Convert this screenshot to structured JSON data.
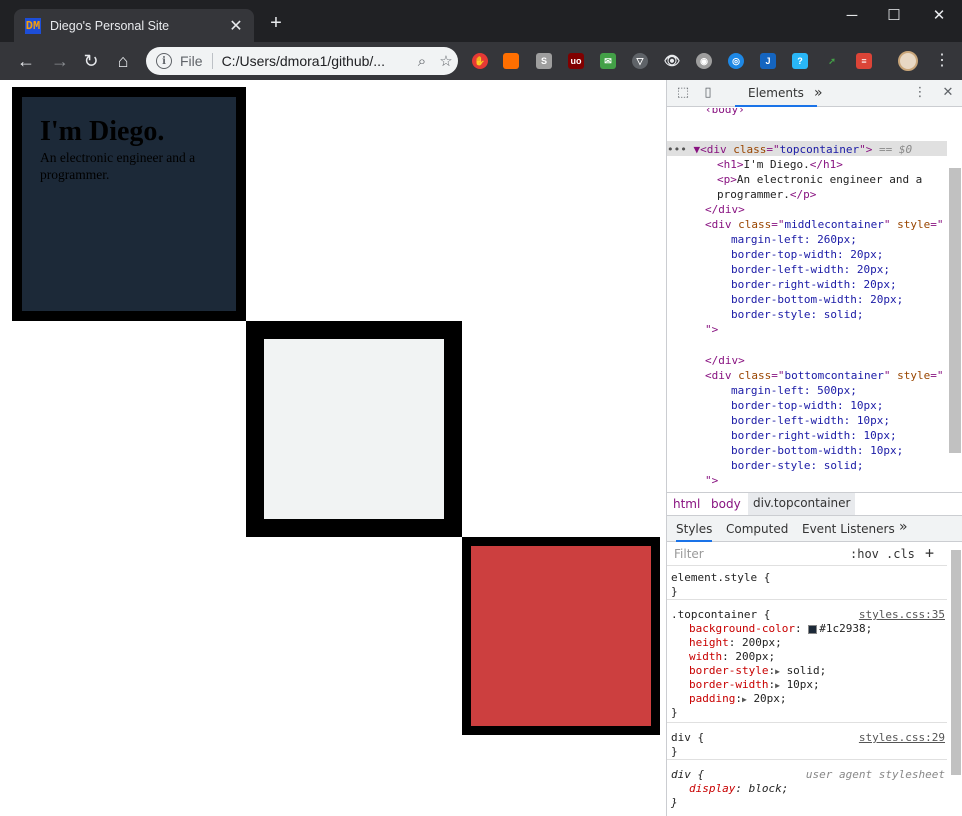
{
  "browser": {
    "tab_title": "Diego's Personal Site",
    "favicon": "DM",
    "file_label": "File",
    "url": "C:/Users/dmora1/github/...",
    "colors": {
      "titlebar": "#202124",
      "toolbar": "#35363a",
      "omnibox": "#f1f3f4"
    }
  },
  "page": {
    "heading": "I'm Diego.",
    "paragraph": "An electronic engineer and a programmer.",
    "colors": {
      "top": "#1c2938",
      "middle": "#f1f3f3",
      "bottom": "#cc3f3f",
      "border": "#000000"
    }
  },
  "devtools": {
    "tab_elements": "Elements",
    "more_tabs": "»",
    "dom_lines": [
      {
        "pre": "  ▼",
        "t1": "<div ",
        "a1": "class",
        "e": "=\"",
        "v1": "topcontainer",
        "q": "\"",
        "t2": ">",
        "c": " == $0"
      },
      {
        "text": "<h1>I'm Diego.</h1>"
      },
      {
        "text": "<p>An electronic engineer and a"
      },
      {
        "text": "programmer.</p>"
      },
      {
        "text": "</div>"
      },
      {
        "text": "<div class=\"middlecontainer\" style=\""
      },
      {
        "text": "margin-left: 260px;"
      },
      {
        "text": "border-top-width: 20px;"
      },
      {
        "text": "border-left-width: 20px;"
      },
      {
        "text": "border-right-width: 20px;"
      },
      {
        "text": "border-bottom-width: 20px;"
      },
      {
        "text": "border-style: solid;"
      },
      {
        "text": "\">"
      },
      {
        "text": ""
      },
      {
        "text": "</div>"
      },
      {
        "text": "<div class=\"bottomcontainer\" style=\""
      },
      {
        "text": "margin-left: 500px;"
      },
      {
        "text": "border-top-width: 10px;"
      },
      {
        "text": "border-left-width: 10px;"
      },
      {
        "text": "border-right-width: 10px;"
      },
      {
        "text": "border-bottom-width: 10px;"
      },
      {
        "text": "border-style: solid;"
      },
      {
        "text": "\">"
      },
      {
        "text": ""
      },
      {
        "text": "</div>"
      }
    ],
    "breadcrumbs": [
      "html",
      "body",
      "div.topcontainer"
    ],
    "styles_tabs": [
      "Styles",
      "Computed",
      "Event Listeners",
      "»"
    ],
    "filter_placeholder": "Filter",
    "hov": ":hov",
    "cls": ".cls",
    "add": "+",
    "rules": {
      "element_style": "element.style {",
      "close": "}",
      "topcontainer_selector": ".topcontainer {",
      "topcontainer_src": "styles.css:35",
      "props": [
        {
          "name": "background-color",
          "value": "#1c2938;"
        },
        {
          "name": "height",
          "value": "200px;"
        },
        {
          "name": "width",
          "value": "200px;"
        },
        {
          "name": "border-style",
          "value": "solid;"
        },
        {
          "name": "border-width",
          "value": "10px;"
        },
        {
          "name": "padding",
          "value": "20px;"
        }
      ],
      "div_selector": "div {",
      "div_src": "styles.css:29",
      "ua_selector": "div {",
      "ua_src": "user agent stylesheet",
      "ua_prop_name": "display",
      "ua_prop_value": "block;"
    }
  }
}
